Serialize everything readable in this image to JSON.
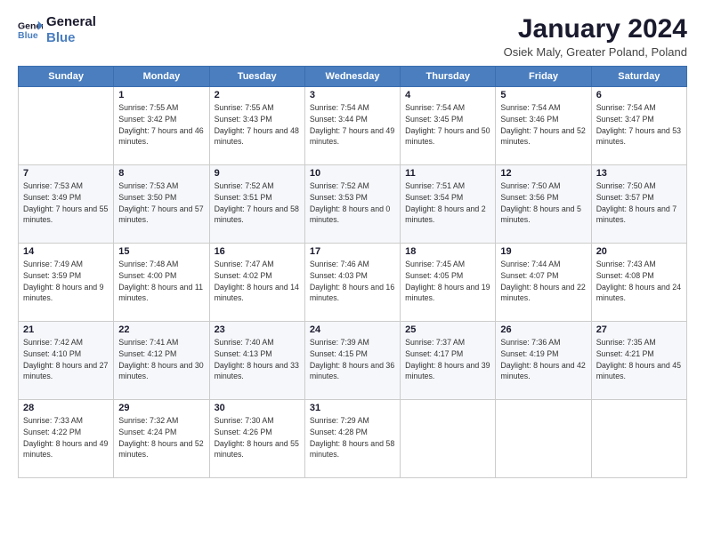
{
  "logo": {
    "line1": "General",
    "line2": "Blue"
  },
  "title": "January 2024",
  "subtitle": "Osiek Maly, Greater Poland, Poland",
  "days_header": [
    "Sunday",
    "Monday",
    "Tuesday",
    "Wednesday",
    "Thursday",
    "Friday",
    "Saturday"
  ],
  "weeks": [
    [
      {
        "day": "",
        "sunrise": "",
        "sunset": "",
        "daylight": ""
      },
      {
        "day": "1",
        "sunrise": "Sunrise: 7:55 AM",
        "sunset": "Sunset: 3:42 PM",
        "daylight": "Daylight: 7 hours and 46 minutes."
      },
      {
        "day": "2",
        "sunrise": "Sunrise: 7:55 AM",
        "sunset": "Sunset: 3:43 PM",
        "daylight": "Daylight: 7 hours and 48 minutes."
      },
      {
        "day": "3",
        "sunrise": "Sunrise: 7:54 AM",
        "sunset": "Sunset: 3:44 PM",
        "daylight": "Daylight: 7 hours and 49 minutes."
      },
      {
        "day": "4",
        "sunrise": "Sunrise: 7:54 AM",
        "sunset": "Sunset: 3:45 PM",
        "daylight": "Daylight: 7 hours and 50 minutes."
      },
      {
        "day": "5",
        "sunrise": "Sunrise: 7:54 AM",
        "sunset": "Sunset: 3:46 PM",
        "daylight": "Daylight: 7 hours and 52 minutes."
      },
      {
        "day": "6",
        "sunrise": "Sunrise: 7:54 AM",
        "sunset": "Sunset: 3:47 PM",
        "daylight": "Daylight: 7 hours and 53 minutes."
      }
    ],
    [
      {
        "day": "7",
        "sunrise": "Sunrise: 7:53 AM",
        "sunset": "Sunset: 3:49 PM",
        "daylight": "Daylight: 7 hours and 55 minutes."
      },
      {
        "day": "8",
        "sunrise": "Sunrise: 7:53 AM",
        "sunset": "Sunset: 3:50 PM",
        "daylight": "Daylight: 7 hours and 57 minutes."
      },
      {
        "day": "9",
        "sunrise": "Sunrise: 7:52 AM",
        "sunset": "Sunset: 3:51 PM",
        "daylight": "Daylight: 7 hours and 58 minutes."
      },
      {
        "day": "10",
        "sunrise": "Sunrise: 7:52 AM",
        "sunset": "Sunset: 3:53 PM",
        "daylight": "Daylight: 8 hours and 0 minutes."
      },
      {
        "day": "11",
        "sunrise": "Sunrise: 7:51 AM",
        "sunset": "Sunset: 3:54 PM",
        "daylight": "Daylight: 8 hours and 2 minutes."
      },
      {
        "day": "12",
        "sunrise": "Sunrise: 7:50 AM",
        "sunset": "Sunset: 3:56 PM",
        "daylight": "Daylight: 8 hours and 5 minutes."
      },
      {
        "day": "13",
        "sunrise": "Sunrise: 7:50 AM",
        "sunset": "Sunset: 3:57 PM",
        "daylight": "Daylight: 8 hours and 7 minutes."
      }
    ],
    [
      {
        "day": "14",
        "sunrise": "Sunrise: 7:49 AM",
        "sunset": "Sunset: 3:59 PM",
        "daylight": "Daylight: 8 hours and 9 minutes."
      },
      {
        "day": "15",
        "sunrise": "Sunrise: 7:48 AM",
        "sunset": "Sunset: 4:00 PM",
        "daylight": "Daylight: 8 hours and 11 minutes."
      },
      {
        "day": "16",
        "sunrise": "Sunrise: 7:47 AM",
        "sunset": "Sunset: 4:02 PM",
        "daylight": "Daylight: 8 hours and 14 minutes."
      },
      {
        "day": "17",
        "sunrise": "Sunrise: 7:46 AM",
        "sunset": "Sunset: 4:03 PM",
        "daylight": "Daylight: 8 hours and 16 minutes."
      },
      {
        "day": "18",
        "sunrise": "Sunrise: 7:45 AM",
        "sunset": "Sunset: 4:05 PM",
        "daylight": "Daylight: 8 hours and 19 minutes."
      },
      {
        "day": "19",
        "sunrise": "Sunrise: 7:44 AM",
        "sunset": "Sunset: 4:07 PM",
        "daylight": "Daylight: 8 hours and 22 minutes."
      },
      {
        "day": "20",
        "sunrise": "Sunrise: 7:43 AM",
        "sunset": "Sunset: 4:08 PM",
        "daylight": "Daylight: 8 hours and 24 minutes."
      }
    ],
    [
      {
        "day": "21",
        "sunrise": "Sunrise: 7:42 AM",
        "sunset": "Sunset: 4:10 PM",
        "daylight": "Daylight: 8 hours and 27 minutes."
      },
      {
        "day": "22",
        "sunrise": "Sunrise: 7:41 AM",
        "sunset": "Sunset: 4:12 PM",
        "daylight": "Daylight: 8 hours and 30 minutes."
      },
      {
        "day": "23",
        "sunrise": "Sunrise: 7:40 AM",
        "sunset": "Sunset: 4:13 PM",
        "daylight": "Daylight: 8 hours and 33 minutes."
      },
      {
        "day": "24",
        "sunrise": "Sunrise: 7:39 AM",
        "sunset": "Sunset: 4:15 PM",
        "daylight": "Daylight: 8 hours and 36 minutes."
      },
      {
        "day": "25",
        "sunrise": "Sunrise: 7:37 AM",
        "sunset": "Sunset: 4:17 PM",
        "daylight": "Daylight: 8 hours and 39 minutes."
      },
      {
        "day": "26",
        "sunrise": "Sunrise: 7:36 AM",
        "sunset": "Sunset: 4:19 PM",
        "daylight": "Daylight: 8 hours and 42 minutes."
      },
      {
        "day": "27",
        "sunrise": "Sunrise: 7:35 AM",
        "sunset": "Sunset: 4:21 PM",
        "daylight": "Daylight: 8 hours and 45 minutes."
      }
    ],
    [
      {
        "day": "28",
        "sunrise": "Sunrise: 7:33 AM",
        "sunset": "Sunset: 4:22 PM",
        "daylight": "Daylight: 8 hours and 49 minutes."
      },
      {
        "day": "29",
        "sunrise": "Sunrise: 7:32 AM",
        "sunset": "Sunset: 4:24 PM",
        "daylight": "Daylight: 8 hours and 52 minutes."
      },
      {
        "day": "30",
        "sunrise": "Sunrise: 7:30 AM",
        "sunset": "Sunset: 4:26 PM",
        "daylight": "Daylight: 8 hours and 55 minutes."
      },
      {
        "day": "31",
        "sunrise": "Sunrise: 7:29 AM",
        "sunset": "Sunset: 4:28 PM",
        "daylight": "Daylight: 8 hours and 58 minutes."
      },
      {
        "day": "",
        "sunrise": "",
        "sunset": "",
        "daylight": ""
      },
      {
        "day": "",
        "sunrise": "",
        "sunset": "",
        "daylight": ""
      },
      {
        "day": "",
        "sunrise": "",
        "sunset": "",
        "daylight": ""
      }
    ]
  ]
}
